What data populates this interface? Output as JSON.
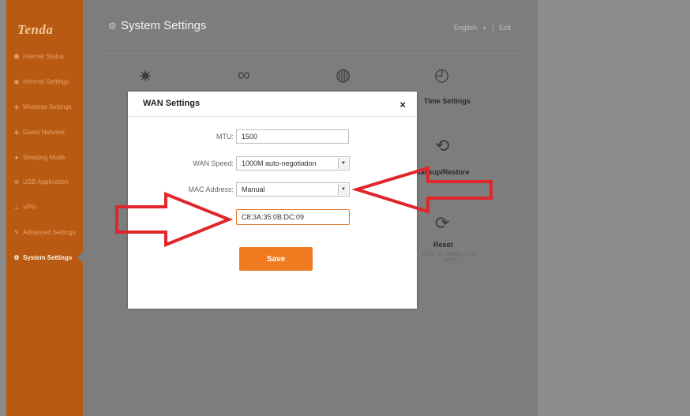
{
  "app": {
    "logo": "Tenda",
    "page_title": "System Settings",
    "language": "English",
    "language_caret": "▼",
    "separator": "|",
    "exit": "Exit"
  },
  "sidebar": {
    "items": [
      {
        "label": "Internet Status",
        "icon": "person-icon",
        "glyph": "☗"
      },
      {
        "label": "Internet Settings",
        "icon": "globe-icon",
        "glyph": "◉"
      },
      {
        "label": "Wireless Settings",
        "icon": "wifi-icon",
        "glyph": "◈"
      },
      {
        "label": "Guest Network",
        "icon": "guest-icon",
        "glyph": "◈"
      },
      {
        "label": "Sleeping Mode",
        "icon": "bulb-icon",
        "glyph": "●"
      },
      {
        "label": "USB Application",
        "icon": "usb-icon",
        "glyph": "⊕"
      },
      {
        "label": "VPN",
        "icon": "vpn-icon",
        "glyph": "⊥"
      },
      {
        "label": "Advanced Settings",
        "icon": "wrench-icon",
        "glyph": "✎"
      },
      {
        "label": "System Settings",
        "icon": "gear-icon",
        "glyph": "⚙",
        "active": true
      }
    ]
  },
  "background_tiles": {
    "time_settings": "Time Settings",
    "backup_restore": "Backup/Restore",
    "reset": "Reset",
    "reset_desc": "Clear all settings of the router"
  },
  "modal": {
    "title": "WAN Settings",
    "close": "×",
    "mtu_label": "MTU:",
    "mtu_value": "1500",
    "wan_speed_label": "WAN Speed:",
    "wan_speed_value": "1000M auto-negotiation",
    "mac_label": "MAC Address:",
    "mac_mode_value": "Manual",
    "mac_value": "C8:3A:35:0B:DC:09",
    "save_label": "Save"
  },
  "colors": {
    "brand": "#b85a12",
    "accent": "#ef7a1f",
    "annotation_arrow": "#e0262b"
  }
}
